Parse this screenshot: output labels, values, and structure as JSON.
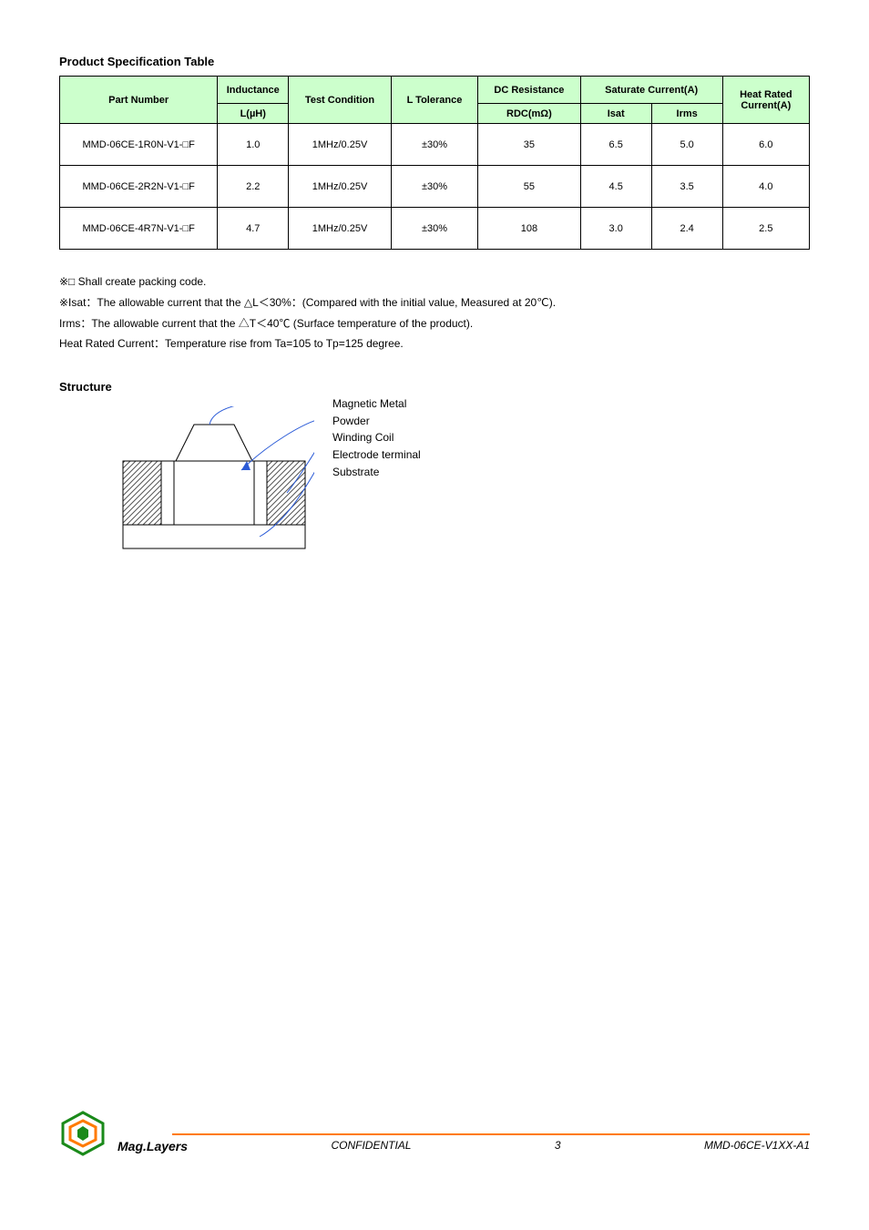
{
  "section_title": "Product Specification Table",
  "headers": {
    "part": "Part Number",
    "inductance": "Inductance",
    "l_uh": "L(µH)",
    "test_cond": "Test Condition",
    "l_tol": "L Tolerance",
    "dc_res": "DC Resistance",
    "rdc_mohm": "RDC(mΩ)",
    "sat_cur": "Saturate Current(A)",
    "isat": "Isat",
    "irms": "Irms",
    "heat": "Heat Rated Current(A)"
  },
  "rows": [
    {
      "part": "MMD-06CE-1R0N-V1-□F",
      "l": "1.0",
      "cond": "1MHz/0.25V",
      "tol": "±30%",
      "rdc": "35",
      "isat": "6.5",
      "irms": "5.0",
      "heat": "6.0"
    },
    {
      "part": "MMD-06CE-2R2N-V1-□F",
      "l": "2.2",
      "cond": "1MHz/0.25V",
      "tol": "±30%",
      "rdc": "55",
      "isat": "4.5",
      "irms": "3.5",
      "heat": "4.0"
    },
    {
      "part": "MMD-06CE-4R7N-V1-□F",
      "l": "4.7",
      "cond": "1MHz/0.25V",
      "tol": "±30%",
      "rdc": "108",
      "isat": "3.0",
      "irms": "2.4",
      "heat": "2.5"
    }
  ],
  "notes": {
    "n1": "※□ Shall create packing code.",
    "n2_a": "※Isat：The allowable current that the",
    "n2_b": "△L＜30%：(Compared with the initial value, Measured at 20℃).",
    "n3_a": "  Irms：The allowable current that the",
    "n3_b": "△T＜40℃ (Surface temperature of the product).",
    "n4": "Heat Rated Current：Temperature rise from Ta=105 to Tp=125 degree."
  },
  "struct_title": "Structure",
  "struct_labels": {
    "a": "Magnetic Metal Powder",
    "b": "Winding Coil",
    "c": "Electrode terminal",
    "d": "Substrate"
  },
  "footer": {
    "company": "Mag.Layers",
    "confidential": "CONFIDENTIAL",
    "page": "3",
    "rev": "MMD-06CE-V1XX-A1"
  }
}
